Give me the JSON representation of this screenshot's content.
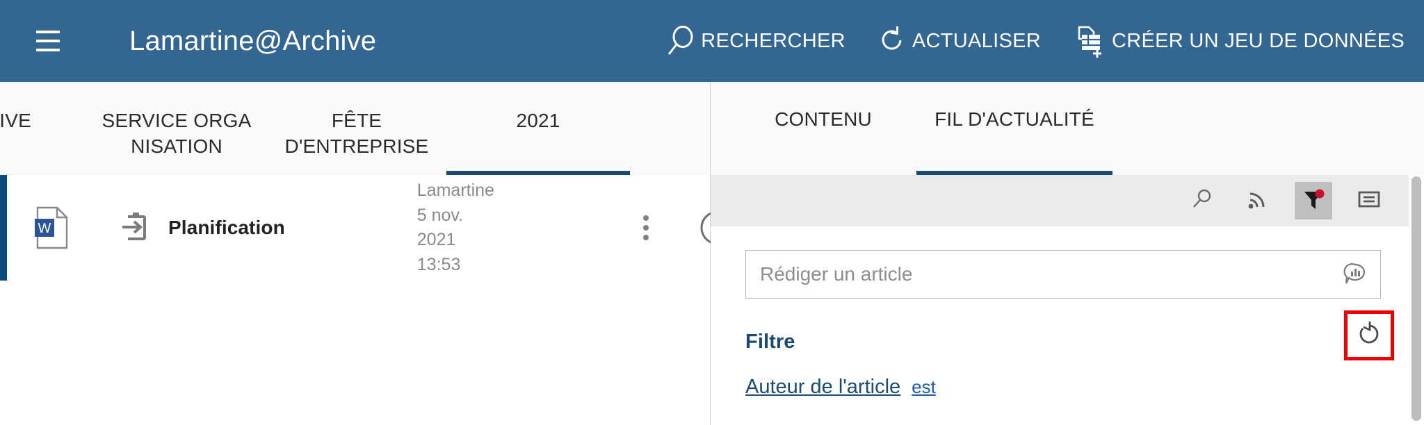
{
  "app_bar": {
    "title": "Lamartine@Archive",
    "menu_icon": "hamburger-menu-icon",
    "background": "#336690",
    "actions": [
      {
        "label": "RECHERCHER",
        "icon": "search-icon"
      },
      {
        "label": "ACTUALISER",
        "icon": "refresh-icon"
      },
      {
        "label": "CRÉER UN JEU DE DONNÉES",
        "icon": "create-dataset-icon"
      }
    ]
  },
  "left_pane": {
    "tabs": [
      {
        "label": "RCHIVE",
        "active": false,
        "partial": true
      },
      {
        "label": "SERVICE ORGA NISATION",
        "active": false
      },
      {
        "label": "FÊTE D'ENTREPRISE",
        "active": false
      },
      {
        "label": "2021",
        "active": true
      }
    ],
    "overflow_icon": "kebab-menu-icon",
    "documents": [
      {
        "file_icon": "word-document-icon",
        "file_icon_letter": "W",
        "type_icon": "import-clipboard-icon",
        "name": "Planification",
        "author": "Lamartine",
        "date": "5 nov. 2021 13:53",
        "row_menu_icon": "kebab-menu-icon",
        "info_icon": "info-circle-icon",
        "selected": true
      }
    ]
  },
  "right_pane": {
    "tabs": [
      {
        "label": "CONTENU",
        "active": false
      },
      {
        "label": "FIL D'ACTUALITÉ",
        "active": true
      }
    ],
    "toolbar": [
      {
        "icon": "search-icon",
        "name": "search",
        "active": false
      },
      {
        "icon": "rss-feed-icon",
        "name": "subscribe",
        "active": false
      },
      {
        "icon": "filter-funnel-icon",
        "name": "filter",
        "active": true,
        "badge_color": "#c8102e"
      },
      {
        "icon": "list-detail-icon",
        "name": "display-mode",
        "active": false
      }
    ],
    "compose": {
      "placeholder": "Rédiger un article",
      "value": "",
      "action_icon": "chat-stats-icon"
    },
    "filter": {
      "title": "Filtre",
      "reset_icon": "reset-undo-icon",
      "reset_highlight_color": "#ee0000",
      "criteria": [
        {
          "field": "Auteur de l'article",
          "operator": "est"
        }
      ]
    }
  },
  "theme": {
    "accent_blue": "#336690",
    "tab_underline": "#1a4a73",
    "selection_bar": "#0c4a7d",
    "link_blue": "#1a5fa8",
    "toolbar_bg": "#ebebeb"
  }
}
